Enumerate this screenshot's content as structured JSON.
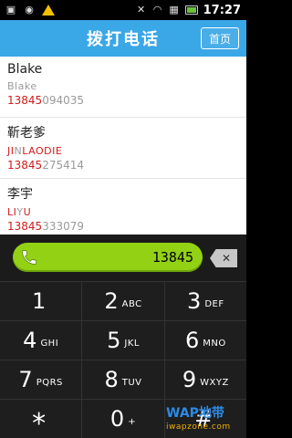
{
  "status_bar": {
    "time": "17:27"
  },
  "header": {
    "title": "拨打电话",
    "home_label": "首页"
  },
  "contacts": [
    {
      "name": "Blake",
      "pinyin": "Blake",
      "phone_prefix": "13845",
      "phone_rest": "094035"
    },
    {
      "name": "靳老爹",
      "pinyin_prefix": "JI",
      "pinyin_mid": "N",
      "pinyin_rest": "LAODIE",
      "phone_prefix": "13845",
      "phone_rest": "275414"
    },
    {
      "name": "李宇",
      "pinyin_prefix": "LI",
      "pinyin_mid": "Y",
      "pinyin_rest": "U",
      "phone_prefix": "13845",
      "phone_rest": "333079"
    }
  ],
  "dialer": {
    "input_value": "13845",
    "keys": [
      [
        {
          "num": "1",
          "letters": ""
        },
        {
          "num": "2",
          "letters": "ABC"
        },
        {
          "num": "3",
          "letters": "DEF"
        }
      ],
      [
        {
          "num": "4",
          "letters": "GHI"
        },
        {
          "num": "5",
          "letters": "JKL"
        },
        {
          "num": "6",
          "letters": "MNO"
        }
      ],
      [
        {
          "num": "7",
          "letters": "PQRS"
        },
        {
          "num": "8",
          "letters": "TUV"
        },
        {
          "num": "9",
          "letters": "WXYZ"
        }
      ],
      [
        {
          "num": "*",
          "letters": ""
        },
        {
          "num": "0",
          "letters": "+"
        },
        {
          "num": "#",
          "letters": ""
        }
      ]
    ]
  },
  "watermark": {
    "brand": "WAP地带",
    "site": "iwapzone.com"
  }
}
